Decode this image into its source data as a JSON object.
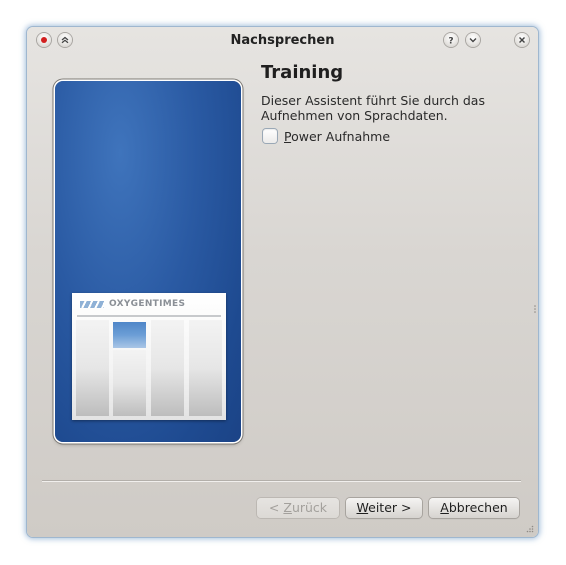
{
  "window": {
    "title": "Nachsprechen"
  },
  "titlebar_buttons": {
    "left": [
      "menu-icon",
      "keep-above-icon"
    ],
    "right": [
      "help-icon",
      "minimize-icon",
      "close-icon"
    ]
  },
  "page": {
    "heading": "Training",
    "description": "Dieser Assistent führt Sie durch das Aufnehmen von Sprachdaten.",
    "checkbox": {
      "mnemonic": "P",
      "label_rest": "ower Aufnahme",
      "checked": false
    }
  },
  "side_image": {
    "logo_text": "OXYGENTIMES"
  },
  "buttons": {
    "back": {
      "prefix": "< ",
      "mnemonic": "Z",
      "rest": "urück",
      "enabled": false
    },
    "next": {
      "mnemonic": "W",
      "rest": "eiter >",
      "enabled": true
    },
    "cancel": {
      "mnemonic": "A",
      "rest": "bbrechen",
      "enabled": true
    }
  },
  "colors": {
    "accent": "#2a5aa3",
    "window_bg": "#d9d6d2",
    "close_dot": "#d21f1f"
  }
}
